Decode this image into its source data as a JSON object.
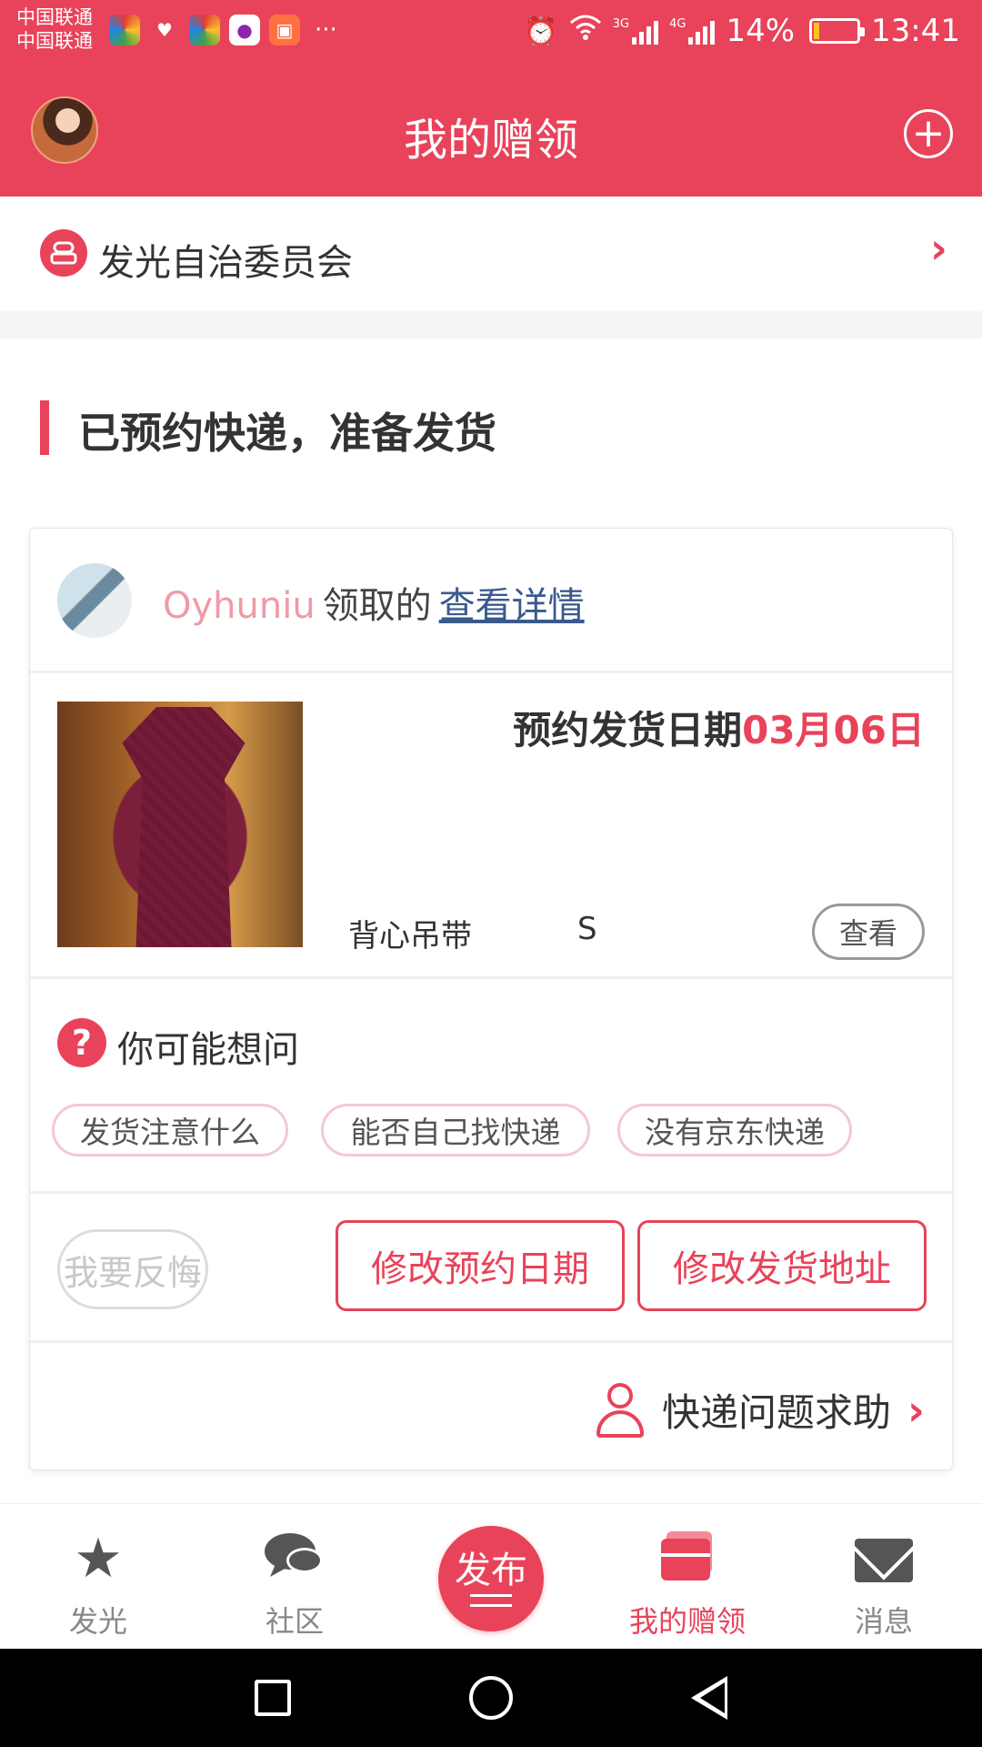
{
  "status_bar": {
    "carrier_1": "中国联通",
    "carrier_2": "中国联通",
    "more": "···",
    "net_3g": "3G",
    "net_4g": "4G",
    "battery": "14%",
    "battery_level": 0.14,
    "time": "13:41",
    "app_icons": [
      "color-wheel-icon",
      "heart-pulse-icon",
      "color-wheel-icon",
      "camera-app-icon",
      "video-app-icon"
    ],
    "alarm_icon": "alarm-icon",
    "wifi_icon": "wifi-icon"
  },
  "header": {
    "title": "我的赠领",
    "add_icon": "plus-circle-icon"
  },
  "committee": {
    "label": "发光自治委员会"
  },
  "section": {
    "title": "已预约快递，准备发货"
  },
  "card": {
    "claimer": {
      "name": "Oyhuniu",
      "text": "领取的",
      "link": "查看详情"
    },
    "shipping": {
      "date_label": "预约发货日期",
      "date_value": "03月06日"
    },
    "item": {
      "name": "背心吊带",
      "size": "S",
      "view_label": "查看"
    },
    "faq": {
      "title": "你可能想问",
      "chips": [
        "发货注意什么",
        "能否自己找快递",
        "没有京东快递"
      ]
    },
    "actions": {
      "regret": "我要反悔",
      "change_date": "修改预约日期",
      "change_address": "修改发货地址"
    },
    "help": {
      "label": "快递问题求助"
    }
  },
  "bottom_nav": {
    "items": [
      {
        "label": "发光",
        "icon": "star-icon"
      },
      {
        "label": "社区",
        "icon": "chat-bubbles-icon"
      },
      {
        "label": "发布",
        "icon": "publish-icon"
      },
      {
        "label": "我的赠领",
        "icon": "gift-box-icon"
      },
      {
        "label": "消息",
        "icon": "envelope-icon"
      }
    ],
    "active": "我的赠领"
  },
  "colors": {
    "brand": "#e8435a",
    "link": "#3a5a8c",
    "username": "#f09aa6"
  }
}
